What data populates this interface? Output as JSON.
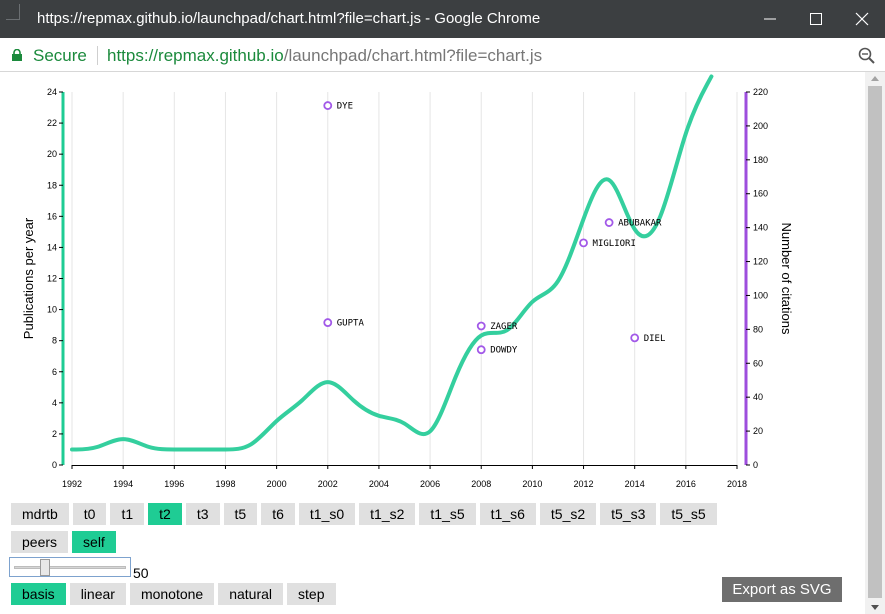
{
  "window": {
    "title": "https://repmax.github.io/launchpad/chart.html?file=chart.js - Google Chrome"
  },
  "address": {
    "secure_label": "Secure",
    "url_proto": "https://",
    "url_host": "repmax.github.io",
    "url_rest": "/launchpad/chart.html?file=chart.js"
  },
  "colors": {
    "curve": "#34cf9e",
    "left_axis": "#1fcc94",
    "right_axis": "#9d4edd",
    "points": "#a259e8",
    "active_button": "#1fcc94"
  },
  "chart_data": {
    "type": "line",
    "ylabel": "Publications per year",
    "y2label": "Number of citations",
    "xlim": [
      1992,
      2018
    ],
    "ylim": [
      0,
      24
    ],
    "y2lim": [
      0,
      220
    ],
    "x_ticks": [
      "1992",
      "1994",
      "1996",
      "1998",
      "2000",
      "2002",
      "2004",
      "2006",
      "2008",
      "2010",
      "2012",
      "2014",
      "2016",
      "2018"
    ],
    "y_ticks": [
      "0",
      "2",
      "4",
      "6",
      "8",
      "10",
      "12",
      "14",
      "16",
      "18",
      "20",
      "22",
      "24"
    ],
    "y2_ticks": [
      "0",
      "20",
      "40",
      "60",
      "80",
      "100",
      "120",
      "140",
      "160",
      "180",
      "200",
      "220"
    ],
    "series": [
      {
        "x": [
          1992,
          1993,
          1994,
          1995,
          1996,
          1997,
          1998,
          1999,
          2000,
          2001,
          2002,
          2003,
          2004,
          2005,
          2006,
          2007,
          2008,
          2009,
          2010,
          2011,
          2012,
          2013,
          2014,
          2015,
          2016,
          2017
        ],
        "values": [
          1,
          1,
          2,
          1,
          1,
          1,
          1,
          1,
          3,
          4,
          6,
          4,
          3,
          3,
          1,
          6,
          9,
          8,
          11,
          11,
          16,
          20,
          14,
          15,
          22,
          25
        ]
      }
    ],
    "points": [
      {
        "label": "DYE",
        "x": 2002,
        "y2": 212
      },
      {
        "label": "GUPTA",
        "x": 2002,
        "y2": 84
      },
      {
        "label": "ZAGER",
        "x": 2008,
        "y2": 82
      },
      {
        "label": "DOWDY",
        "x": 2008,
        "y2": 68
      },
      {
        "label": "MIGLIORI",
        "x": 2012,
        "y2": 131
      },
      {
        "label": "ABUBAKAR",
        "x": 2013,
        "y2": 143
      },
      {
        "label": "DIEL",
        "x": 2014,
        "y2": 75
      }
    ]
  },
  "buttons": {
    "row1": [
      {
        "label": "mdrtb",
        "active": false
      },
      {
        "label": "t0",
        "active": false
      },
      {
        "label": "t1",
        "active": false
      },
      {
        "label": "t2",
        "active": true
      },
      {
        "label": "t3",
        "active": false
      },
      {
        "label": "t5",
        "active": false
      },
      {
        "label": "t6",
        "active": false
      },
      {
        "label": "t1_s0",
        "active": false
      },
      {
        "label": "t1_s2",
        "active": false
      },
      {
        "label": "t1_s5",
        "active": false
      },
      {
        "label": "t1_s6",
        "active": false
      },
      {
        "label": "t5_s2",
        "active": false
      },
      {
        "label": "t5_s3",
        "active": false
      },
      {
        "label": "t5_s5",
        "active": false
      }
    ],
    "row2": [
      {
        "label": "peers",
        "active": false
      },
      {
        "label": "self",
        "active": true
      }
    ],
    "row4": [
      {
        "label": "basis",
        "active": true
      },
      {
        "label": "linear",
        "active": false
      },
      {
        "label": "monotone",
        "active": false
      },
      {
        "label": "natural",
        "active": false
      },
      {
        "label": "step",
        "active": false
      }
    ]
  },
  "slider": {
    "value": "50",
    "fraction": 0.25
  },
  "export_label": "Export as SVG"
}
